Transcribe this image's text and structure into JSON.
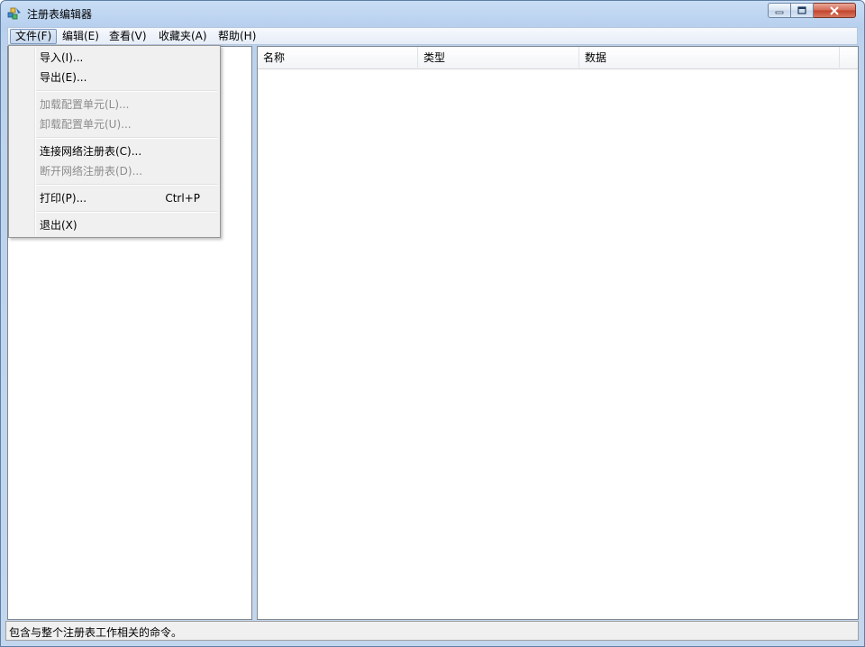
{
  "window": {
    "title": "注册表编辑器"
  },
  "menubar": [
    {
      "label": "文件(F)"
    },
    {
      "label": "编辑(E)"
    },
    {
      "label": "查看(V)"
    },
    {
      "label": "收藏夹(A)"
    },
    {
      "label": "帮助(H)"
    }
  ],
  "file_menu": {
    "items": [
      {
        "label": "导入(I)...",
        "enabled": true
      },
      {
        "label": "导出(E)...",
        "enabled": true
      },
      {
        "label": "加载配置单元(L)...",
        "enabled": false
      },
      {
        "label": "卸载配置单元(U)...",
        "enabled": false
      },
      {
        "label": "连接网络注册表(C)...",
        "enabled": true
      },
      {
        "label": "断开网络注册表(D)...",
        "enabled": false
      },
      {
        "label": "打印(P)...",
        "shortcut": "Ctrl+P",
        "enabled": true
      },
      {
        "label": "退出(X)",
        "enabled": true
      }
    ]
  },
  "list": {
    "columns": [
      "名称",
      "类型",
      "数据"
    ]
  },
  "status": {
    "text": "包含与整个注册表工作相关的命令。"
  },
  "colors": {
    "title_gradient_top": "#c9def5",
    "close_button": "#c2432c",
    "disabled_text": "#8d8d8d"
  }
}
